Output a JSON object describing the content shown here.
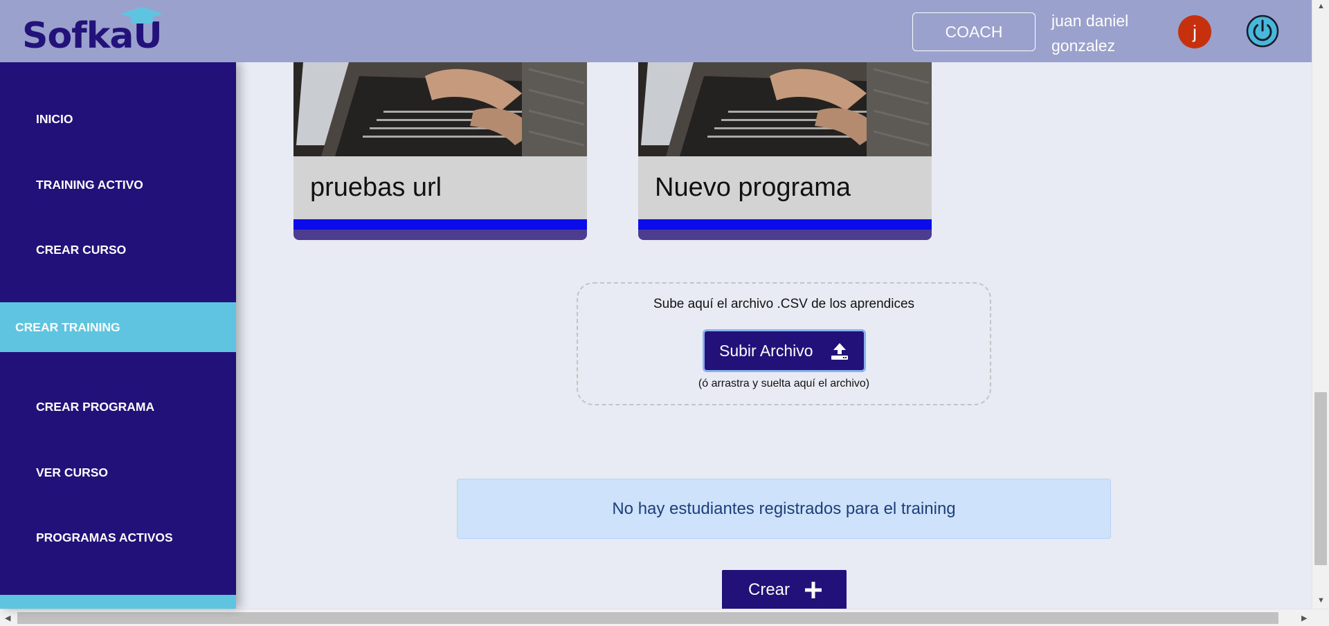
{
  "header": {
    "brand": "SofkaU",
    "role_button": "COACH",
    "user_name": "juan daniel gonzalez",
    "avatar_initial": "j",
    "colors": {
      "background": "#9aa1cd",
      "avatar": "#c7300d",
      "power": "#48b8d8"
    }
  },
  "sidebar": {
    "items": [
      {
        "label": "INICIO"
      },
      {
        "label": "TRAINING ACTIVO"
      },
      {
        "label": "CREAR CURSO"
      },
      {
        "label": "CREAR TRAINING",
        "active": true
      },
      {
        "label": "CREAR PROGRAMA"
      },
      {
        "label": "VER CURSO"
      },
      {
        "label": "PROGRAMAS ACTIVOS"
      }
    ],
    "colors": {
      "background": "#221178",
      "active": "#5fc4e0"
    }
  },
  "cards": [
    {
      "title": "pruebas url",
      "image": "laptop-typing-image"
    },
    {
      "title": "Nuevo programa",
      "image": "laptop-typing-image"
    }
  ],
  "upload": {
    "title": "Sube aquí el archivo .CSV de los aprendices",
    "button_label": "Subir Archivo",
    "button_icon": "upload-icon",
    "hint": "(ó arrastra y suelta aquí el archivo)"
  },
  "alert": {
    "message": "No hay estudiantes registrados para el training"
  },
  "actions": {
    "create_label": "Crear",
    "create_icon": "plus-icon"
  }
}
